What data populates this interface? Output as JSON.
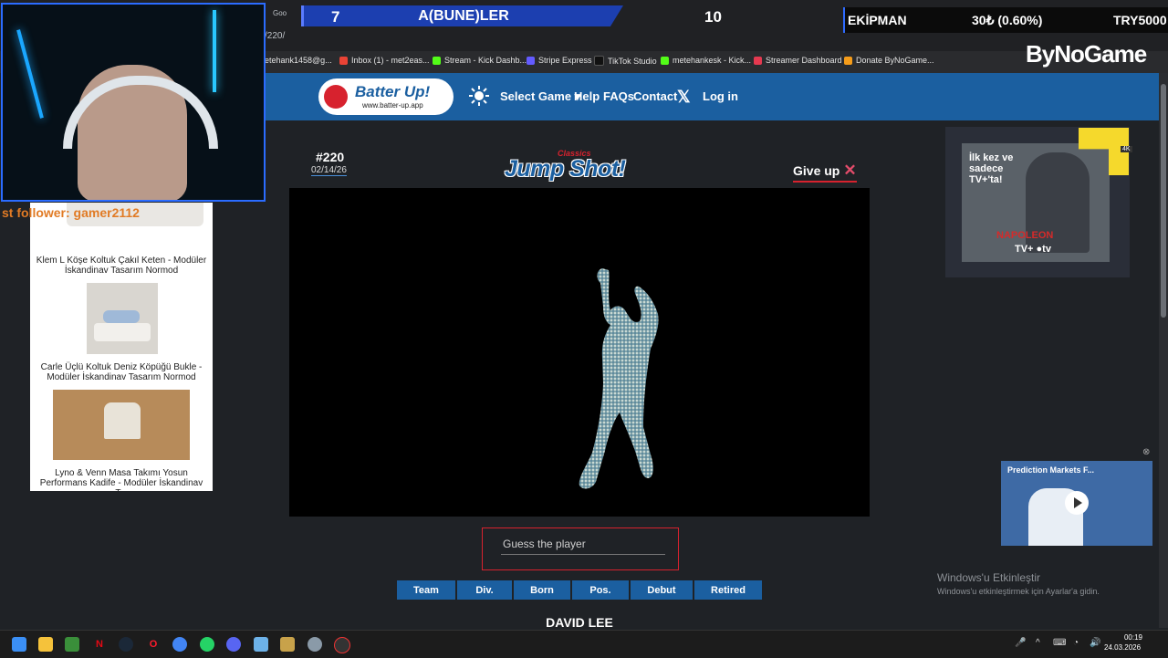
{
  "browser": {
    "tab_fragment": "Goo",
    "address": "/220/",
    "bookmarks": [
      "etehank1458@g...",
      "Inbox (1) - met2eas...",
      "Stream - Kick Dashb...",
      "Stripe Express",
      "TikTok Studio",
      "metehankesk - Kick...",
      "Streamer Dashboard",
      "Donate ByNoGame..."
    ]
  },
  "overlay": {
    "score_left": "7",
    "team": "A(BUNE)LER",
    "score_right": "10",
    "ekipman_label": "EKİPMAN",
    "ekipman_value": "30₺ (0.60%)",
    "ekipman_total": "TRY5000",
    "follower_text": "st follower: gamer2112",
    "brand": "ByNoGame"
  },
  "site": {
    "logo_title": "Batter Up!",
    "logo_url": "www.batter-up.app",
    "nav": {
      "select_game": "Select Game ▾",
      "help": "Help",
      "faqs": "FAQs",
      "contact": "Contact",
      "login": "Log in"
    }
  },
  "game": {
    "number": "#220",
    "date": "02/14/26",
    "classics": "Classics",
    "title": "Jump Shot!",
    "give_up": "Give up",
    "guess_placeholder": "Guess the player",
    "hint_buttons": [
      "Team",
      "Div.",
      "Born",
      "Pos.",
      "Debut",
      "Retired"
    ],
    "last_guess": "DAVID LEE"
  },
  "left_ad": {
    "items": [
      "Klem L Köşe Koltuk Çakıl Keten - Modüler İskandinav Tasarım Normod",
      "Carle Üçlü Koltuk Deniz Köpüğü Bukle - Modüler İskandinav Tasarım Normod",
      "Lyno & Venn Masa Takımı Yosun Performans Kadife - Modüler İskandinav T..."
    ]
  },
  "right_ad": {
    "headline": "İlk kez ve sadece TV+'ta!",
    "movie": "NAPOLEON",
    "platform": "TV+ ●tv",
    "badge": "4K"
  },
  "video": {
    "title": "Prediction Markets F..."
  },
  "windows": {
    "activate_title": "Windows'u Etkinleştir",
    "activate_sub": "Windows'u etkinleştirmek için Ayarlar'a gidin.",
    "time": "00:19",
    "date": "24.03.2026"
  },
  "colors": {
    "brand_blue": "#1b5fa0",
    "accent_red": "#d7222e",
    "page_bg": "#1f2226"
  }
}
